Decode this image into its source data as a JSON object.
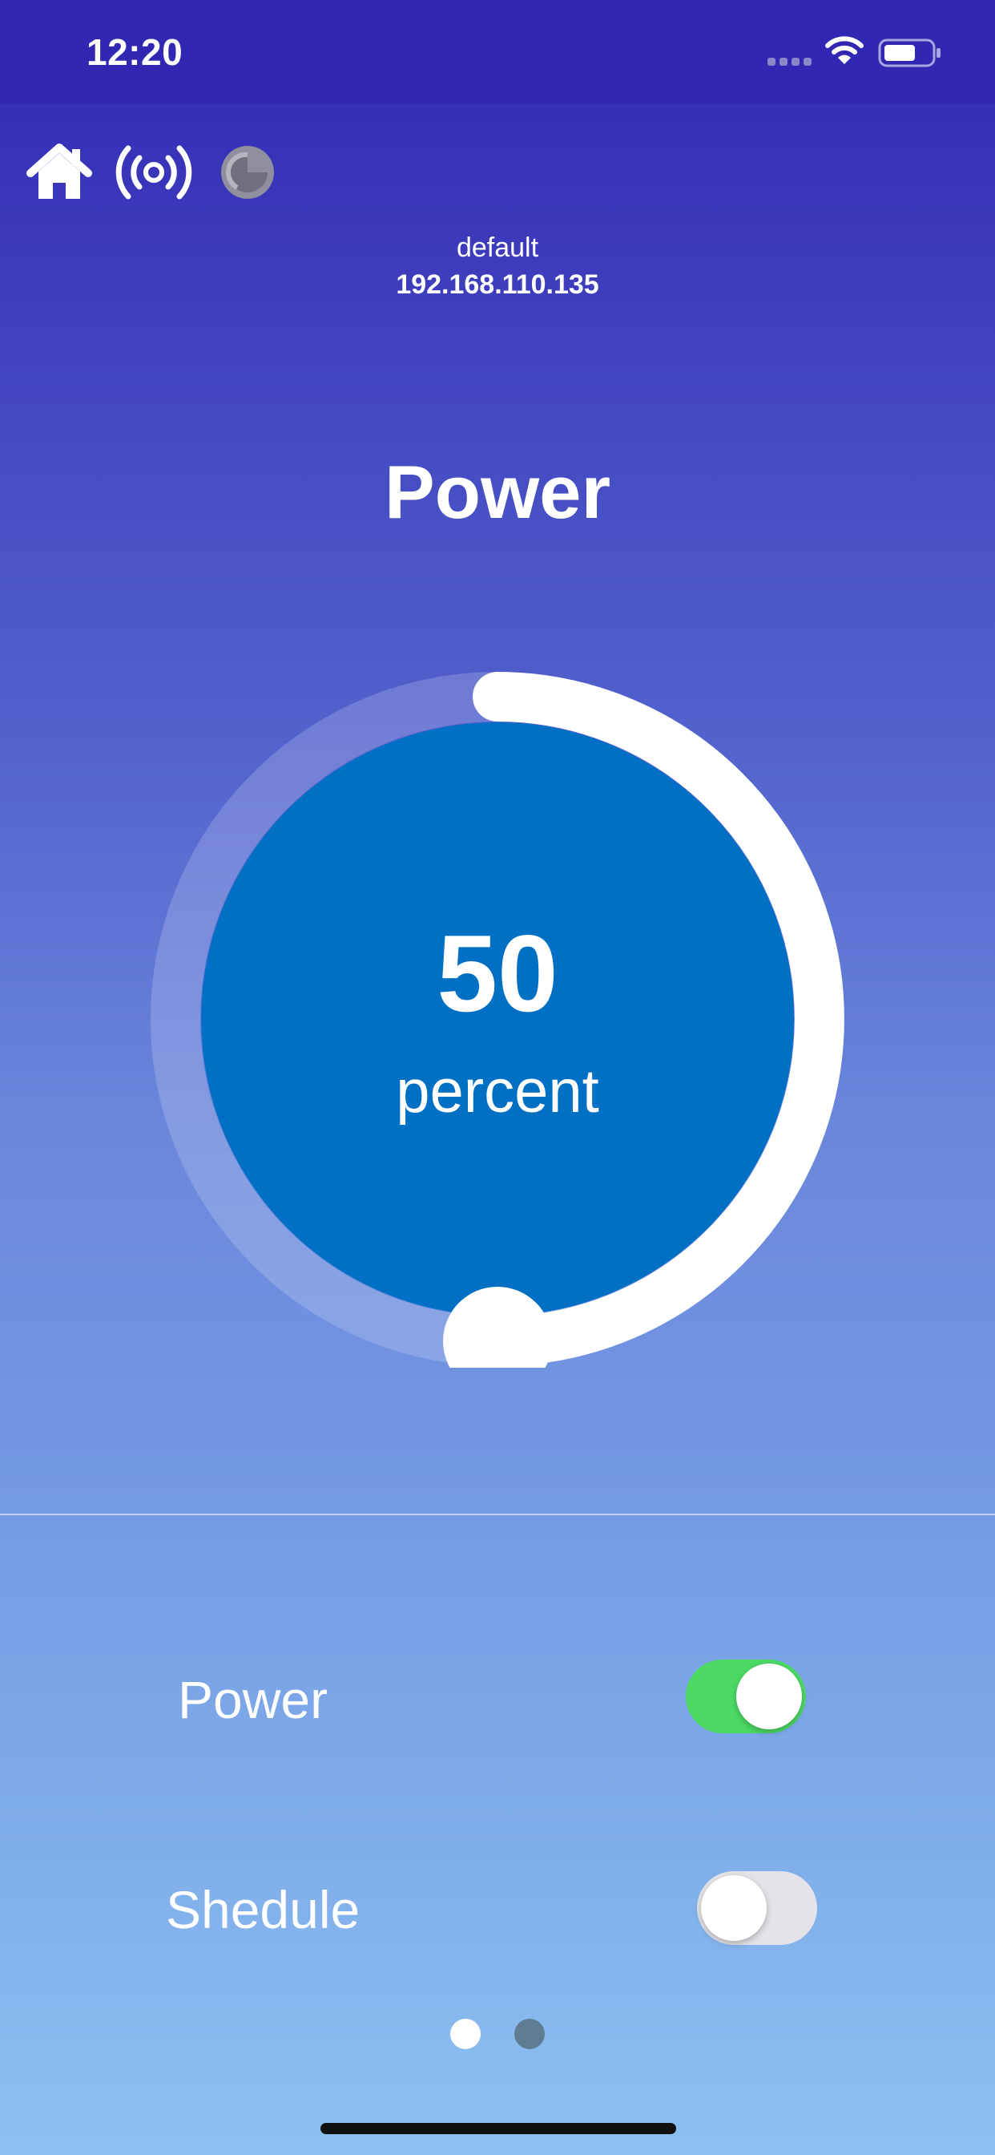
{
  "status_bar": {
    "time": "12:20",
    "icons": [
      "cellular-signal-icon",
      "wifi-icon",
      "battery-icon"
    ]
  },
  "toolbar": {
    "icons": [
      "home-icon",
      "broadcast-icon",
      "loading-spinner-icon"
    ]
  },
  "device": {
    "name": "default",
    "ip": "192.168.110.135"
  },
  "page_title": "Power",
  "dial": {
    "value": "50",
    "unit": "percent",
    "level_percent": 50,
    "colors": {
      "inner": "#0070c4",
      "track": "rgba(255,255,255,0.18)",
      "progress": "#ffffff"
    }
  },
  "rows": [
    {
      "label": "Power",
      "on": true
    },
    {
      "label": "Shedule",
      "on": false
    }
  ],
  "toggle_colors": {
    "on": "#4cd964",
    "off": "#e3e3e8"
  },
  "pagination": {
    "count": 2,
    "active_index": 0
  }
}
